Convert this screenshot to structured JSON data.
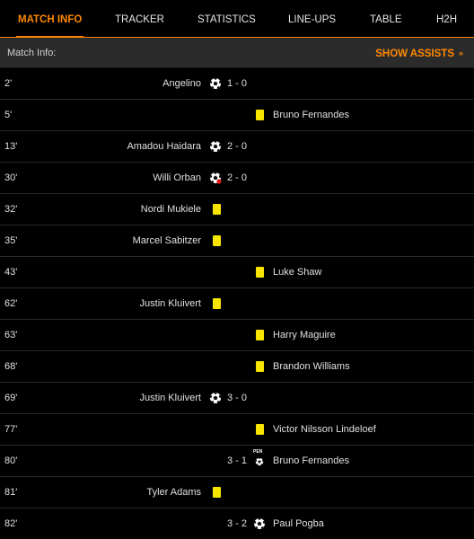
{
  "tabs": [
    "MATCH INFO",
    "TRACKER",
    "STATISTICS",
    "LINE-UPS",
    "TABLE",
    "H2H"
  ],
  "active_tab": 0,
  "subheader": {
    "title": "Match Info:",
    "assists_label": "SHOW ASSISTS",
    "chevron": "»"
  },
  "colors": {
    "accent": "#ff8800",
    "card_yellow": "#f7e500",
    "background": "#000000",
    "row_border": "#2a2a2a"
  },
  "events": [
    {
      "minute": "2'",
      "side": "home",
      "type": "goal",
      "player": "Angelino",
      "score": "1 - 0"
    },
    {
      "minute": "5'",
      "side": "away",
      "type": "yellow",
      "player": "Bruno Fernandes"
    },
    {
      "minute": "13'",
      "side": "home",
      "type": "goal",
      "player": "Amadou Haidara",
      "score": "2 - 0"
    },
    {
      "minute": "30'",
      "side": "home",
      "type": "goal-disallowed",
      "player": "Willi Orban",
      "score": "2 - 0"
    },
    {
      "minute": "32'",
      "side": "home",
      "type": "yellow",
      "player": "Nordi Mukiele"
    },
    {
      "minute": "35'",
      "side": "home",
      "type": "yellow",
      "player": "Marcel Sabitzer"
    },
    {
      "minute": "43'",
      "side": "away",
      "type": "yellow",
      "player": "Luke Shaw"
    },
    {
      "minute": "62'",
      "side": "home",
      "type": "yellow",
      "player": "Justin Kluivert"
    },
    {
      "minute": "63'",
      "side": "away",
      "type": "yellow",
      "player": "Harry Maguire"
    },
    {
      "minute": "68'",
      "side": "away",
      "type": "yellow",
      "player": "Brandon Williams"
    },
    {
      "minute": "69'",
      "side": "home",
      "type": "goal",
      "player": "Justin Kluivert",
      "score": "3 - 0"
    },
    {
      "minute": "77'",
      "side": "away",
      "type": "yellow",
      "player": "Victor Nilsson Lindeloef"
    },
    {
      "minute": "80'",
      "side": "away",
      "type": "penalty",
      "player": "Bruno Fernandes",
      "score": "3 - 1",
      "pen_label": "PEN"
    },
    {
      "minute": "81'",
      "side": "home",
      "type": "yellow",
      "player": "Tyler Adams"
    },
    {
      "minute": "82'",
      "side": "away",
      "type": "goal",
      "player": "Paul Pogba",
      "score": "3 - 2"
    }
  ]
}
